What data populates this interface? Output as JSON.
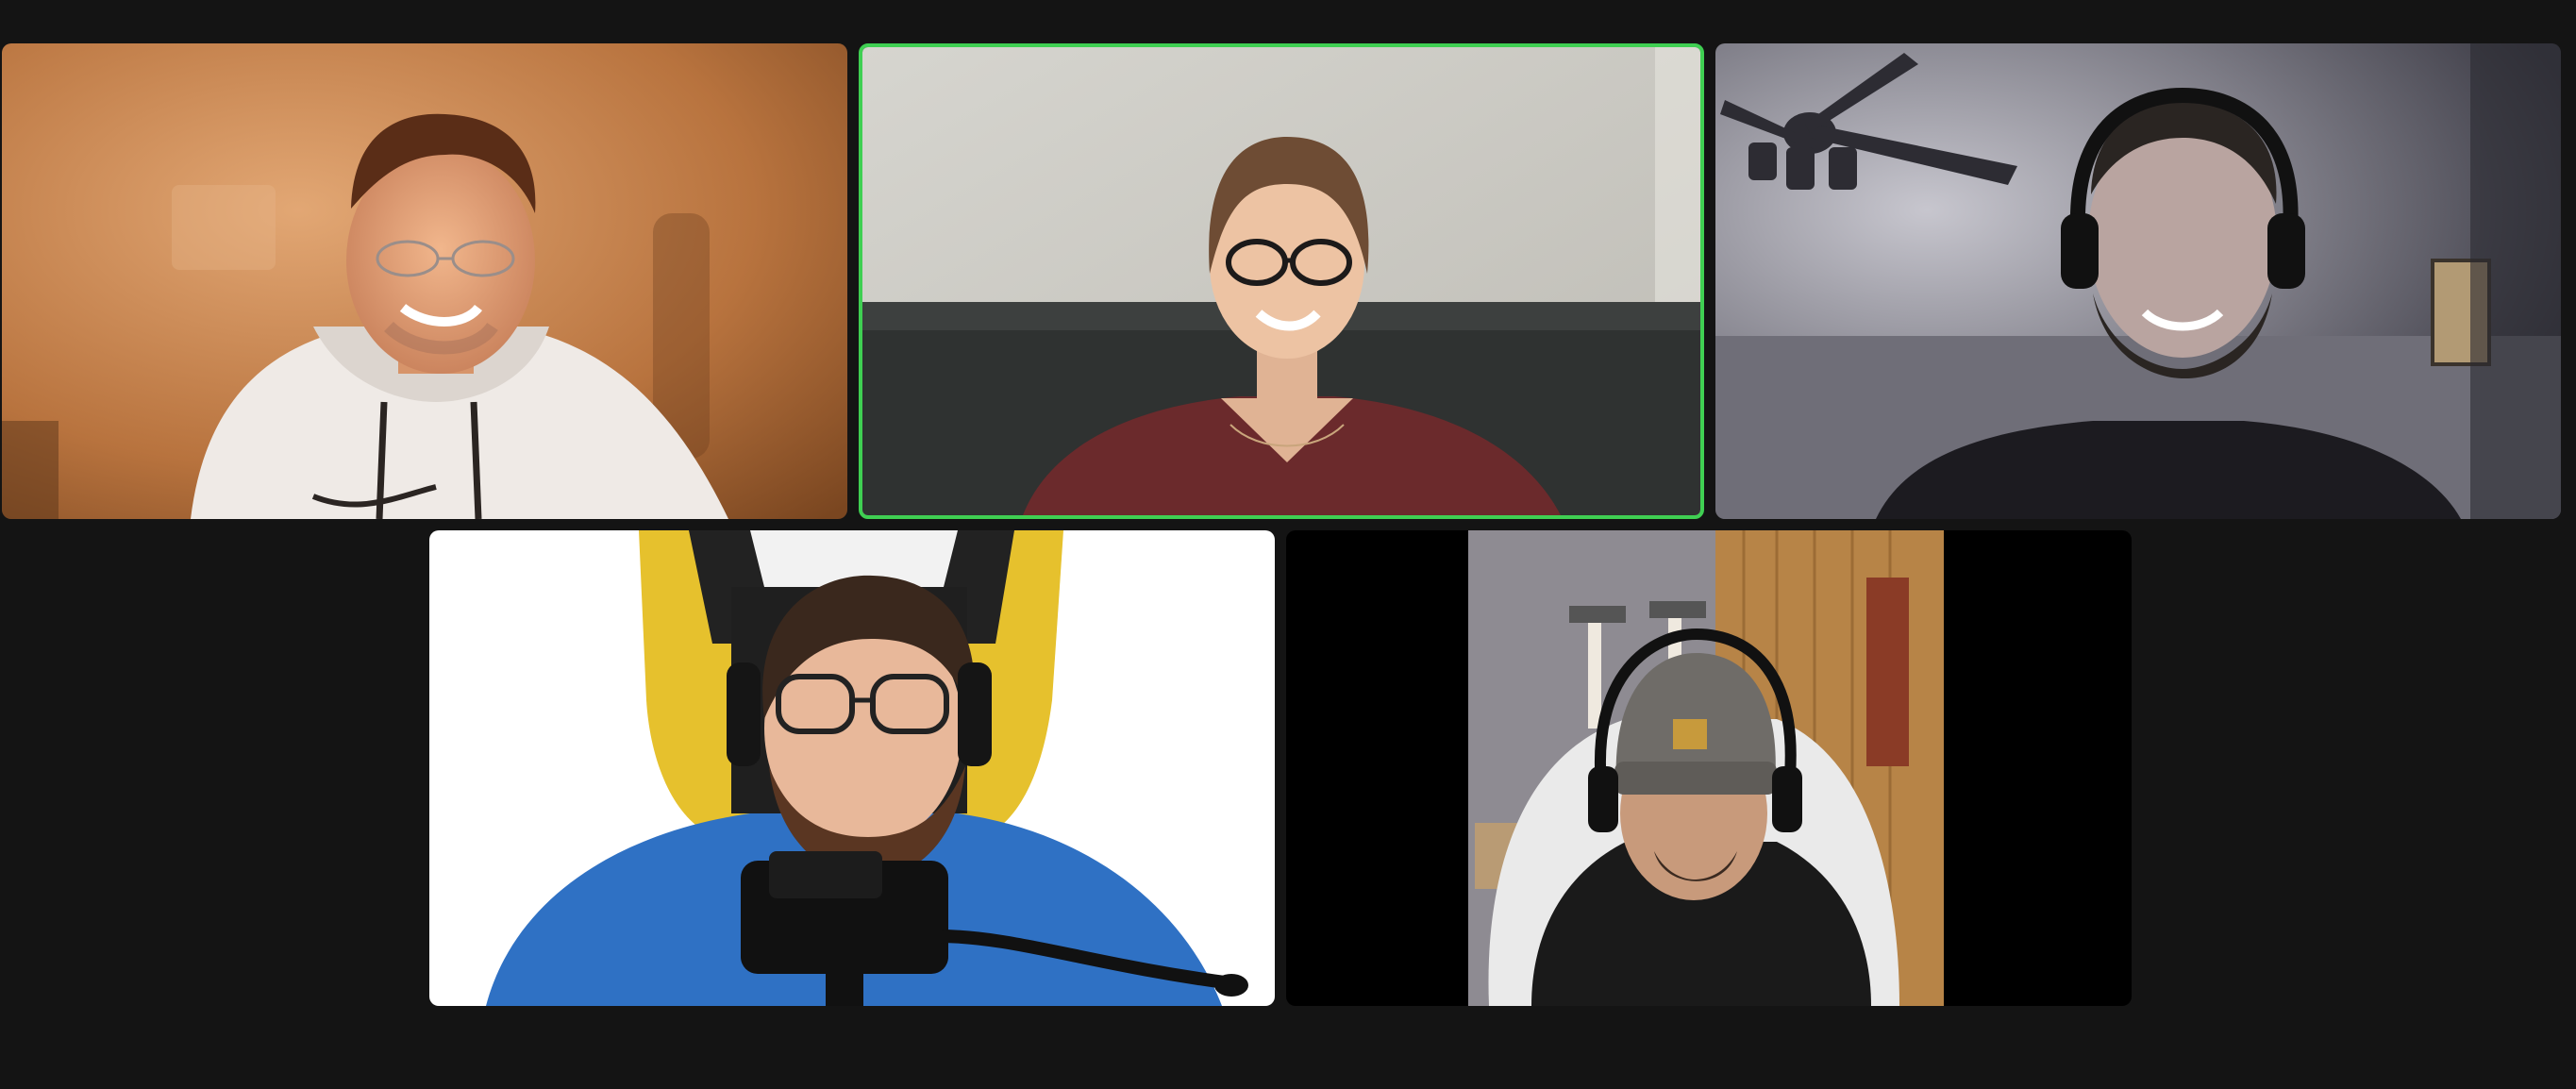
{
  "meeting": {
    "view": "gallery",
    "active_speaker_color": "#3fcf52",
    "background_color": "#141414"
  },
  "participants": [
    {
      "tile": 1,
      "speaking": false,
      "scene": "warm-orange-room",
      "icon": "participant-video"
    },
    {
      "tile": 2,
      "speaking": true,
      "scene": "grey-wall-couch",
      "icon": "participant-video"
    },
    {
      "tile": 3,
      "speaking": false,
      "scene": "dim-room-ceiling-fan",
      "icon": "participant-video"
    },
    {
      "tile": 4,
      "speaking": false,
      "scene": "white-wall-gaming-chair-microphone",
      "icon": "participant-video"
    },
    {
      "tile": 5,
      "speaking": false,
      "scene": "letterboxed-wood-panel-room",
      "icon": "participant-video"
    }
  ]
}
